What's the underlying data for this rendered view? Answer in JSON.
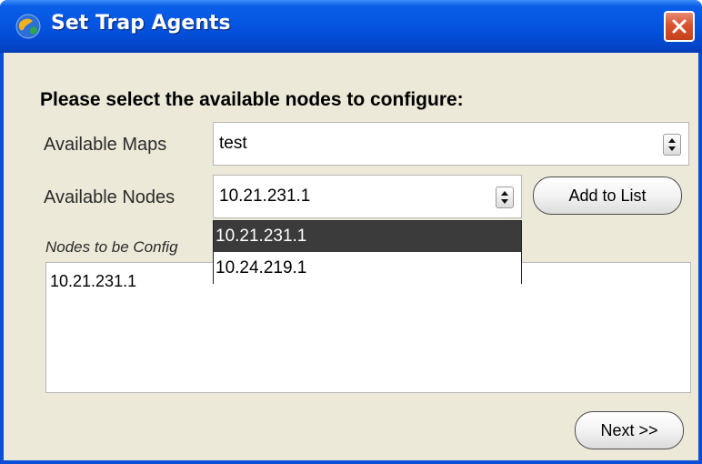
{
  "window": {
    "title": "Set Trap Agents",
    "icon": "globe-icon",
    "close_icon": "close-icon"
  },
  "form": {
    "heading": "Please select the available nodes to configure:",
    "maps_label": "Available Maps",
    "maps_value": "test",
    "nodes_label": "Available Nodes",
    "nodes_value": "10.21.231.1",
    "add_button": "Add to List",
    "list_label": "Nodes to be Config",
    "list_items": [
      "10.21.231.1"
    ],
    "dropdown_options": [
      "10.21.231.1",
      "10.24.219.1"
    ],
    "dropdown_selected_index": 0,
    "next_button": "Next >>"
  },
  "colors": {
    "titlebar": "#0554e0",
    "close_button": "#d9532f",
    "window_bg": "#ece9d8",
    "selected_option": "#3b3b3b"
  }
}
